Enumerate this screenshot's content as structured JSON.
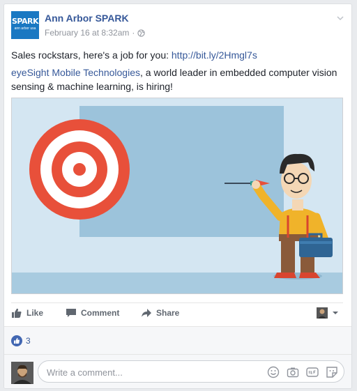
{
  "post": {
    "page_name": "Ann Arbor SPARK",
    "logo_text": "SPARK",
    "logo_subtext": "ann arbor usa",
    "timestamp": "February 16 at 8:32am",
    "separator": "·",
    "text_line1_prefix": "Sales rockstars, here's a job for you: ",
    "link_url": "http://bit.ly/2Hmgl7s",
    "company_link": "eyeSight Mobile Technologies",
    "text_line2_rest": ", a world leader in embedded computer vision sensing & machine learning, is hiring!"
  },
  "actions": {
    "like": "Like",
    "comment": "Comment",
    "share": "Share"
  },
  "reactions": {
    "count": "3"
  },
  "comment_box": {
    "placeholder": "Write a comment..."
  },
  "colors": {
    "link": "#365899",
    "like_blue": "#4267b2",
    "logo_blue": "#1a78c2"
  },
  "icons": [
    "chevron-down-icon",
    "globe-icon",
    "like-icon",
    "comment-icon",
    "share-icon",
    "emoji-icon",
    "camera-icon",
    "gif-icon",
    "sticker-icon"
  ]
}
